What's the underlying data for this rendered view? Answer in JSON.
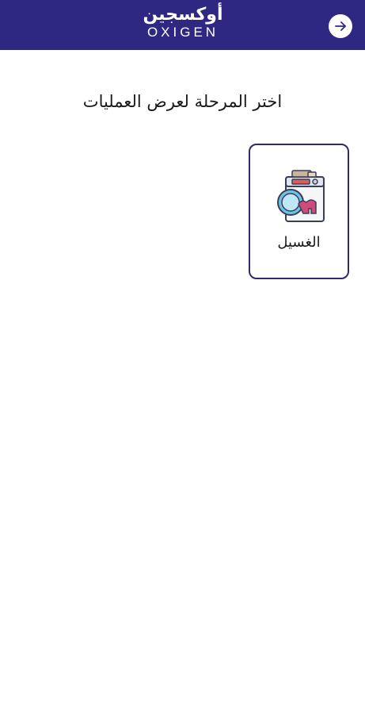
{
  "header": {
    "logo_ar": "أوكسجين",
    "logo_en": "OXIGEN",
    "background_color": "#2e2883",
    "back_icon": "arrow-right-icon"
  },
  "main": {
    "title": "اختر المرحلة لعرض العمليات",
    "stages": [
      {
        "label": "الغسيل",
        "icon": "washing-machine-icon"
      }
    ]
  }
}
